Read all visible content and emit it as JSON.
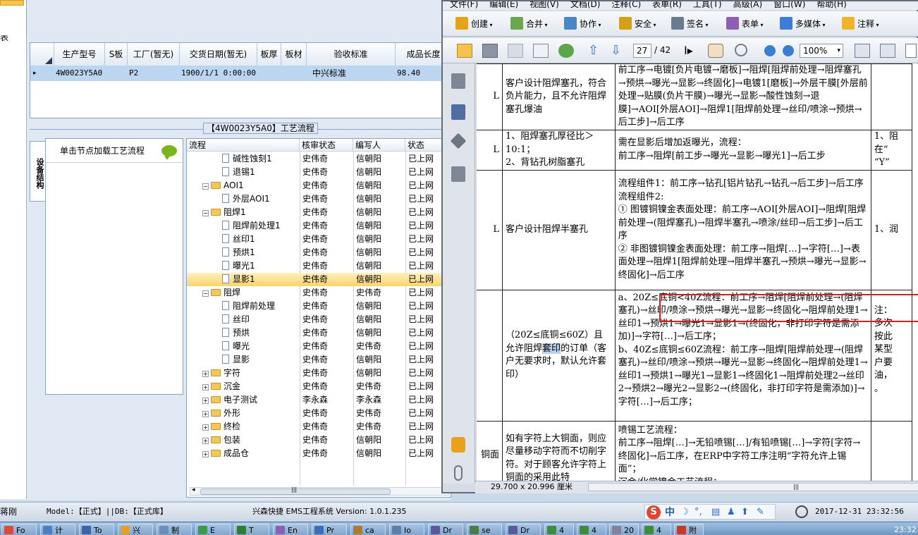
{
  "left_app": {
    "side_char": "表",
    "grid": {
      "headers": [
        "生产型号",
        "S板",
        "工厂(暂无)",
        "交货日期(暂无)",
        "板厚",
        "板材",
        "验收标准",
        "成品长度"
      ],
      "row": {
        "marker": "▸",
        "model": "4W0023Y5A0",
        "factory": "P2",
        "date": "1900/1/1 0:00:00",
        "standard": "中兴标准",
        "length": "98.40"
      }
    },
    "process_title": "【4W0023Y5A0】工艺流程",
    "vertical_tab": "设备结构",
    "node_hint": "单击节点加载工艺流程",
    "tree_headers": [
      "流程",
      "核审状态",
      "编写人",
      "状态"
    ],
    "tree_rows": [
      {
        "name": "碱性蚀刻1",
        "type": "doc",
        "pm": "",
        "reviewer": "史伟奇",
        "writer": "信朝阳",
        "status": "已上网"
      },
      {
        "name": "退锡1",
        "type": "doc",
        "pm": "",
        "reviewer": "史伟奇",
        "writer": "信朝阳",
        "status": "已上网"
      },
      {
        "name": "AOI1",
        "type": "folder",
        "pm": "−",
        "reviewer": "史伟奇",
        "writer": "信朝阳",
        "status": "已上网"
      },
      {
        "name": "外层AOI1",
        "type": "doc",
        "pm": "",
        "reviewer": "史伟奇",
        "writer": "信朝阳",
        "status": "已上网"
      },
      {
        "name": "阻焊1",
        "type": "folder",
        "pm": "−",
        "reviewer": "史伟奇",
        "writer": "信朝阳",
        "status": "已上网"
      },
      {
        "name": "阻焊前处理1",
        "type": "doc",
        "pm": "",
        "reviewer": "史伟奇",
        "writer": "信朝阳",
        "status": "已上网"
      },
      {
        "name": "丝印1",
        "type": "doc",
        "pm": "",
        "reviewer": "史伟奇",
        "writer": "信朝阳",
        "status": "已上网"
      },
      {
        "name": "预烘1",
        "type": "doc",
        "pm": "",
        "reviewer": "史伟奇",
        "writer": "信朝阳",
        "status": "已上网"
      },
      {
        "name": "曝光1",
        "type": "doc",
        "pm": "",
        "reviewer": "史伟奇",
        "writer": "信朝阳",
        "status": "已上网"
      },
      {
        "name": "显影1",
        "type": "doc",
        "pm": "",
        "reviewer": "史伟奇",
        "writer": "信朝阳",
        "status": "已上网",
        "selected": true
      },
      {
        "name": "阻焊",
        "type": "folder",
        "pm": "−",
        "reviewer": "史伟奇",
        "writer": "史伟奇",
        "status": "已上网"
      },
      {
        "name": "阻焊前处理",
        "type": "doc",
        "pm": "",
        "reviewer": "史伟奇",
        "writer": "信朝阳",
        "status": "已上网"
      },
      {
        "name": "丝印",
        "type": "doc",
        "pm": "",
        "reviewer": "史伟奇",
        "writer": "信朝阳",
        "status": "已上网"
      },
      {
        "name": "预烘",
        "type": "doc",
        "pm": "",
        "reviewer": "史伟奇",
        "writer": "信朝阳",
        "status": "已上网"
      },
      {
        "name": "曝光",
        "type": "doc",
        "pm": "",
        "reviewer": "史伟奇",
        "writer": "史伟奇",
        "status": "已上网"
      },
      {
        "name": "显影",
        "type": "doc",
        "pm": "",
        "reviewer": "史伟奇",
        "writer": "信朝阳",
        "status": "已上网"
      },
      {
        "name": "字符",
        "type": "folder",
        "pm": "+",
        "reviewer": "史伟奇",
        "writer": "信朝阳",
        "status": "已上网"
      },
      {
        "name": "沉金",
        "type": "folder",
        "pm": "+",
        "reviewer": "史伟奇",
        "writer": "史伟奇",
        "status": "已上网"
      },
      {
        "name": "电子测试",
        "type": "folder",
        "pm": "+",
        "reviewer": "李永森",
        "writer": "李永森",
        "status": "已上网"
      },
      {
        "name": "外形",
        "type": "folder",
        "pm": "+",
        "reviewer": "史伟奇",
        "writer": "史伟奇",
        "status": "已上网"
      },
      {
        "name": "终检",
        "type": "folder",
        "pm": "+",
        "reviewer": "史伟奇",
        "writer": "史伟奇",
        "status": "已上网"
      },
      {
        "name": "包装",
        "type": "folder",
        "pm": "+",
        "reviewer": "史伟奇",
        "writer": "信朝阳",
        "status": "已上网"
      },
      {
        "name": "成品仓",
        "type": "folder",
        "pm": "+",
        "reviewer": "史伟奇",
        "writer": "信朝阳",
        "status": "已上网"
      }
    ],
    "scroll_glyph": "|||"
  },
  "pdf": {
    "menu": [
      "文件(F)",
      "编辑(E)",
      "视图(V)",
      "文档(D)",
      "注释(C)",
      "表单(R)",
      "工具(T)",
      "高级(A)",
      "窗口(W)",
      "帮助(H)"
    ],
    "toolbar1": [
      {
        "label": "创建",
        "icon": "create-icon",
        "color": "#e6a21a"
      },
      {
        "label": "合并",
        "icon": "combine-icon",
        "color": "#6aa84f"
      },
      {
        "label": "协作",
        "icon": "collaborate-icon",
        "color": "#4a86c5"
      },
      {
        "label": "安全",
        "icon": "lock-icon",
        "color": "#d4a017"
      },
      {
        "label": "签名",
        "icon": "pen-icon",
        "color": "#6a7b8f"
      },
      {
        "label": "表单",
        "icon": "form-icon",
        "color": "#8a5fb5"
      },
      {
        "label": "多媒体",
        "icon": "multimedia-icon",
        "color": "#3b7dd8"
      },
      {
        "label": "注释",
        "icon": "comment-icon",
        "color": "#f0b429"
      }
    ],
    "page_current": "27",
    "page_total": "/ 42",
    "zoom": "100%",
    "size_readout": "29.700 x 20.996 厘米",
    "scroll_glyph": "|||",
    "table": [
      {
        "c0": "L",
        "c1": "客户设计阻焊塞孔，符合负片能力，且不允许阻焊塞孔爆油",
        "c2": "前工序→电镀[负片电镀→磨板]→阻焊[阻焊前处理→阻焊塞孔→预烘→曝光→显影→终固化]→电镀1[磨板]→外层干膜[外层前处理→贴膜(负片干膜)→曝光→显影→酸性蚀刻→退膜]→AOI[外层AOI]→阻焊1[阻焊前处理→丝印/喷涂→预烘→后工步]→后工序",
        "c3": ""
      },
      {
        "c0": "L",
        "c1": "1、阻焊塞孔厚径比＞10:1；\n2、背钻孔树脂塞孔",
        "c2": "需在显影后增加返曝光，流程：\n前工序→阻焊[前工步→曝光→显影→曝光1]→后工步",
        "c3": "1、阻\n在“\n“Y”"
      },
      {
        "c0": "L",
        "c1": "客户设计阻焊半塞孔",
        "c2": "流程组件1：前工序→钻孔[铝片钻孔→钻孔→后工步]→后工序\n流程组件2:\n① 图镀铜镍金表面处理：前工序→AOI[外层AOI]→阻焊[阻焊前处理→(阻焊塞孔)→阻焊半塞孔→喷涂/丝印→后工步]→后工序\n② 非图镀铜镍金表面处理：前工序→阻焊[…]→字符[…]→表面处理→阻焊1[阻焊前处理→阻焊半塞孔→预烘→曝光→显影→终固化]→后工序",
        "c3": "1、润"
      },
      {
        "c0": "",
        "c1_pre": "（20Z≤底铜≤60Z）且允许阻焊",
        "c1_hl": "套印",
        "c1_post": "的订单（客户无要求时，默认允许套印）",
        "c2": "a、20Z≤底铜<40Z流程：前工序→阻焊[阻焊前处理→(阻焊塞孔)→丝印/喷涂→预烘→曝光→显影→终固化→阻焊前处理1→丝印1→预烘1→曝光1→显影1→(终固化，非打印字符是需添加)]→字符[…]→后工序；\nb、40Z≤底铜≤60Z流程：前工序→阻焊[阻焊前处理→(阻焊塞孔)→丝印/喷涂→预烘→曝光→显影→终固化→阻焊前处理1→丝印1→预烘1→曝光1→显影1→终固化1→阻焊前处理2→丝印2→预烘2→曝光2→显影2→(终固化，非打印字符是需添加)]→字符[…]→后工序；",
        "c3": "注：\n多次\n按此\n某型\n户要\n油，\n。"
      },
      {
        "c0": "铜面",
        "c1": "如有字符上大铜面，则应尽量移动字符而不切削字符。对于顾客允许字符上铜面的采用此特",
        "c2": "喷锡工艺流程：\n前工序→阻焊[…]→无铅喷锡[…]/有铅喷锡[…]→字符[字符→终固化]→后工序，在ERP中字符工序注明“字符允许上锡面”；\n沉金/化学镍金工艺流程：",
        "c3": ""
      }
    ]
  },
  "status_bar": {
    "left_label": "蒋刚",
    "model_db": "Model:【正式】||DB:【正式库】",
    "app_version": "兴森快捷 EMS工程系统 Version: 1.0.1.235",
    "ime_logo": "S",
    "ime_lang": "中",
    "datetime": "2017-12-31 23:32:56"
  },
  "taskbar": {
    "items": [
      "Fo",
      "计",
      "To",
      "兴",
      "制",
      "E",
      "T",
      "En",
      "Pr",
      "ca",
      "Io",
      "Dr",
      "se",
      "Dr",
      "4",
      "4",
      "20",
      "4",
      "附"
    ],
    "time": "23:32"
  }
}
